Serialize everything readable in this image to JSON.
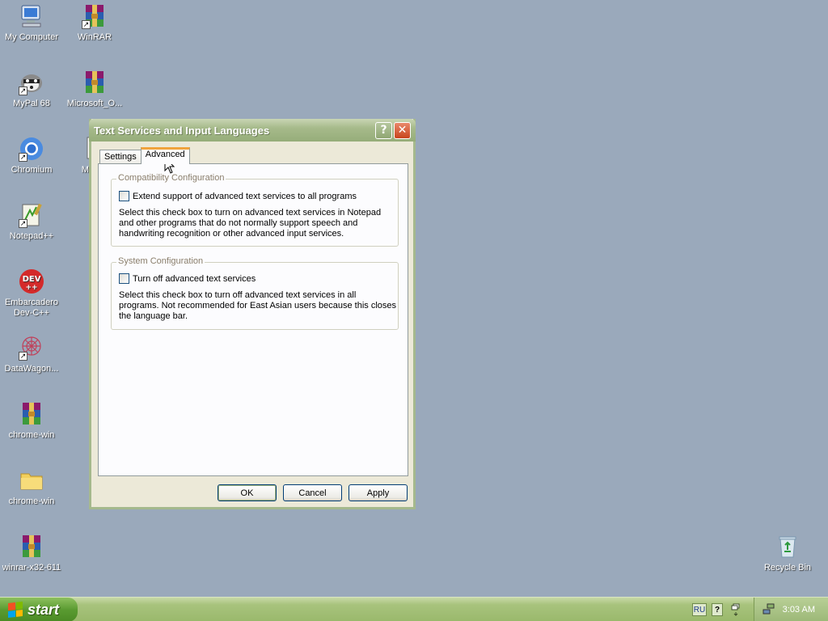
{
  "desktop": {
    "icons": [
      {
        "label": "My Computer",
        "icon": "computer-icon"
      },
      {
        "label": "WinRAR",
        "icon": "winrar-icon"
      },
      {
        "label": "MyPal 68",
        "icon": "mypal-icon"
      },
      {
        "label": "Microsoft_O...",
        "icon": "winrar-icon"
      },
      {
        "label": "Chromium",
        "icon": "chromium-icon"
      },
      {
        "label": "Micros",
        "icon": "document-icon"
      },
      {
        "label": "Notepad++",
        "icon": "notepadpp-icon"
      },
      {
        "label": "Embarcadero Dev-C++",
        "icon": "devcpp-icon"
      },
      {
        "label": "DataWagon...",
        "icon": "datawagon-icon"
      },
      {
        "label": "chrome-win",
        "icon": "winrar-icon"
      },
      {
        "label": "chrome-win",
        "icon": "folder-icon"
      },
      {
        "label": "winrar-x32-611",
        "icon": "winrar-icon"
      },
      {
        "label": "Recycle Bin",
        "icon": "recycle-bin-icon"
      }
    ],
    "dev_icon_text": "DEV"
  },
  "dialog": {
    "title": "Text Services and Input Languages",
    "help_glyph": "?",
    "close_glyph": "✕",
    "tabs": [
      {
        "label": "Settings",
        "active": false
      },
      {
        "label": "Advanced",
        "active": true
      }
    ],
    "compat": {
      "legend": "Compatibility Configuration",
      "checkbox_label": "Extend support of advanced text services to all programs",
      "checked": false,
      "description": "Select this check box to turn on advanced text services in Notepad and other programs that do not normally support speech and handwriting recognition or other advanced input services."
    },
    "system": {
      "legend": "System Configuration",
      "checkbox_label": "Turn off advanced text services",
      "checked": false,
      "description": "Select this check box to turn off advanced text services in all programs. Not recommended for East Asian users because this closes the language bar."
    },
    "buttons": {
      "ok": "OK",
      "cancel": "Cancel",
      "apply": "Apply"
    }
  },
  "taskbar": {
    "start_label": "start",
    "language": "RU",
    "help_glyph": "?",
    "clock": "3:03 AM"
  },
  "colors": {
    "desktop_bg": "#9aa9bb",
    "titlebar": "#a6ba8b",
    "taskbar": "#a8c37d",
    "start_button": "#5a9b31"
  }
}
